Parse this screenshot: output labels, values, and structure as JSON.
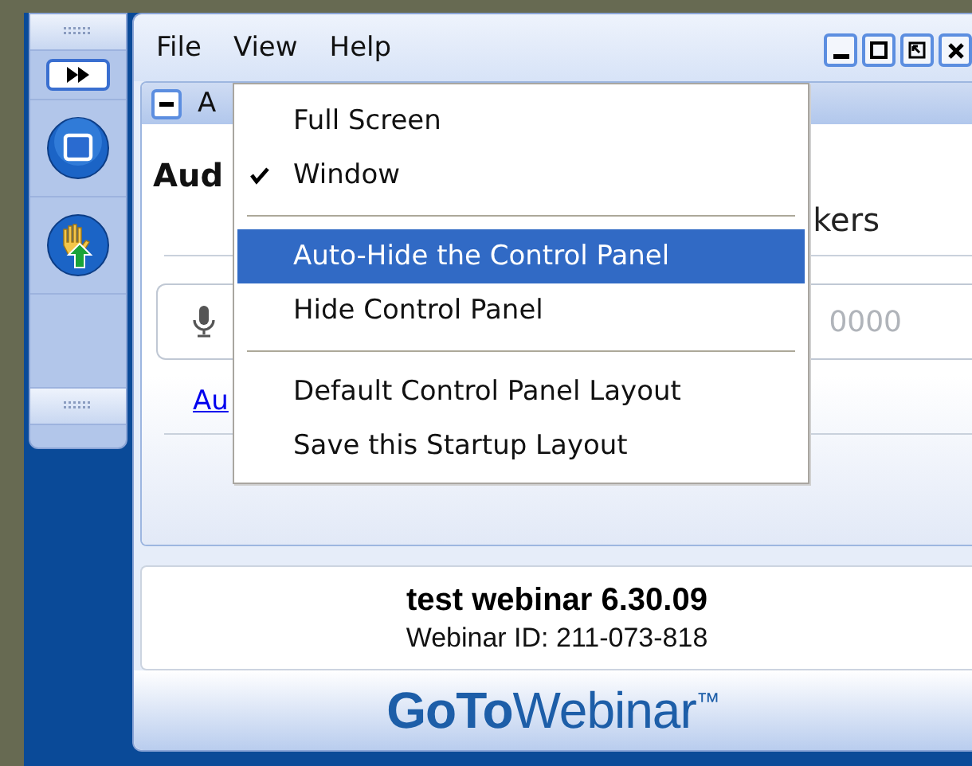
{
  "menubar": [
    {
      "label": "File"
    },
    {
      "label": "View"
    },
    {
      "label": "Help"
    }
  ],
  "view_menu": [
    {
      "kind": "item",
      "label": "Full Screen",
      "checked": false,
      "selected": false
    },
    {
      "kind": "item",
      "label": "Window",
      "checked": true,
      "selected": false
    },
    {
      "kind": "separator"
    },
    {
      "kind": "item",
      "label": "Auto-Hide the Control Panel",
      "checked": false,
      "selected": true
    },
    {
      "kind": "item",
      "label": "Hide Control Panel",
      "checked": false,
      "selected": false
    },
    {
      "kind": "separator"
    },
    {
      "kind": "item",
      "label": "Default Control Panel Layout",
      "checked": false,
      "selected": false
    },
    {
      "kind": "item",
      "label": "Save this Startup Layout",
      "checked": false,
      "selected": false
    }
  ],
  "panel": {
    "header": "A",
    "heading": "Aud",
    "side_text": "kers",
    "field_text": "0000",
    "link": "Au"
  },
  "webinar": {
    "title": "test webinar 6.30.09",
    "id": "Webinar ID: 211-073-818"
  },
  "logo": {
    "bold": "GoTo",
    "light": "Webinar",
    "mark": "™"
  }
}
